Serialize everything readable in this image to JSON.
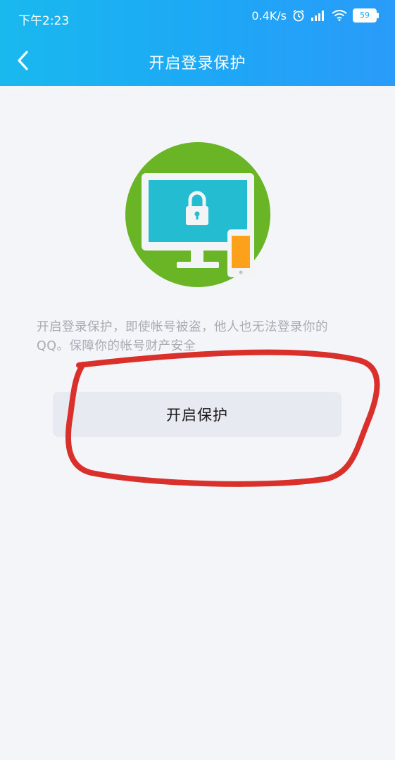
{
  "status_bar": {
    "time": "下午2:23",
    "network_speed": "0.4K/s",
    "battery_level": "59",
    "icons": [
      "alarm-icon",
      "signal-icon",
      "wifi-icon",
      "battery-icon"
    ]
  },
  "nav": {
    "title": "开启登录保护",
    "back_icon": "chevron-left-icon"
  },
  "content": {
    "illustration_icon": "monitor-lock-phone-icon",
    "description": "开启登录保护，即使帐号被盗，他人也无法登录你的QQ。保障你的帐号财产安全",
    "button_label": "开启保护"
  },
  "colors": {
    "header_gradient_start": "#19b9ee",
    "header_gradient_end": "#2a9bf9",
    "page_background": "#f4f5f9",
    "illustration_green": "#6ab526",
    "screen_teal": "#23bcd0",
    "phone_orange": "#fba21a",
    "button_background": "#e8eaf1",
    "annotation_red": "#d9302c"
  }
}
